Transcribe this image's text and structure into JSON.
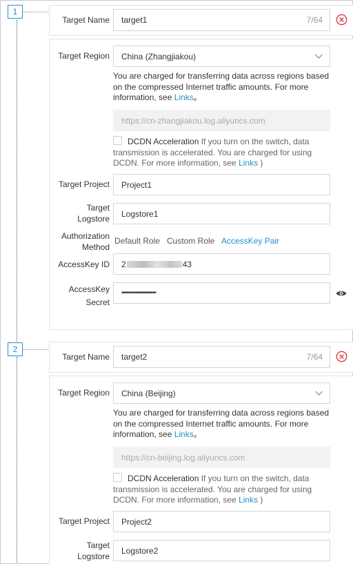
{
  "colors": {
    "accent": "#1f8fd0",
    "danger": "#e2474d",
    "border": "#d4d4d4"
  },
  "targets": [
    {
      "index": "1",
      "name_label": "Target Name",
      "name_value": "target1",
      "name_counter": "7/64",
      "region_label": "Target Region",
      "region_value": "China (Zhangjiakou)",
      "region_note": "You are charged for transferring data across regions based on the compressed Internet traffic amounts. For more information, see ",
      "region_note_link": "Links",
      "region_note_end": "。",
      "endpoint": "https://cn-zhangjiakou.log.aliyuncs.com",
      "dcdn_title": "DCDN Acceleration",
      "dcdn_desc": " If you turn on the switch, data transmission is accelerated. You are charged for using DCDN. For more information, see ",
      "dcdn_link": "Links",
      "dcdn_end": " )",
      "project_label": "Target Project",
      "project_value": "Project1",
      "logstore_label_1": "Target",
      "logstore_label_2": "Logstore",
      "logstore_value": "Logstore1",
      "auth_label_1": "Authorization",
      "auth_label_2": "Method",
      "auth_options": [
        "Default Role",
        "Custom Role",
        "AccessKey Pair"
      ],
      "auth_selected": "AccessKey Pair",
      "ak_id_label": "AccessKey ID",
      "ak_id_value_start": "2",
      "ak_id_value_end": "43",
      "ak_secret_label_1": "AccessKey",
      "ak_secret_label_2": "Secret",
      "ak_secret_value": "••••••••••••••••••••"
    },
    {
      "index": "2",
      "name_label": "Target Name",
      "name_value": "target2",
      "name_counter": "7/64",
      "region_label": "Target Region",
      "region_value": "China (Beijing)",
      "region_note": "You are charged for transferring data across regions based on the compressed Internet traffic amounts. For more information, see ",
      "region_note_link": "Links",
      "region_note_end": "。",
      "endpoint": "https://cn-beijing.log.aliyuncs.com",
      "dcdn_title": "DCDN Acceleration",
      "dcdn_desc": " If you turn on the switch, data transmission is accelerated. You are charged for using DCDN. For more information, see ",
      "dcdn_link": "Links",
      "dcdn_end": " )",
      "project_label": "Target Project",
      "project_value": "Project2",
      "logstore_label_1": "Target",
      "logstore_label_2": "Logstore",
      "logstore_value": "Logstore2"
    }
  ]
}
